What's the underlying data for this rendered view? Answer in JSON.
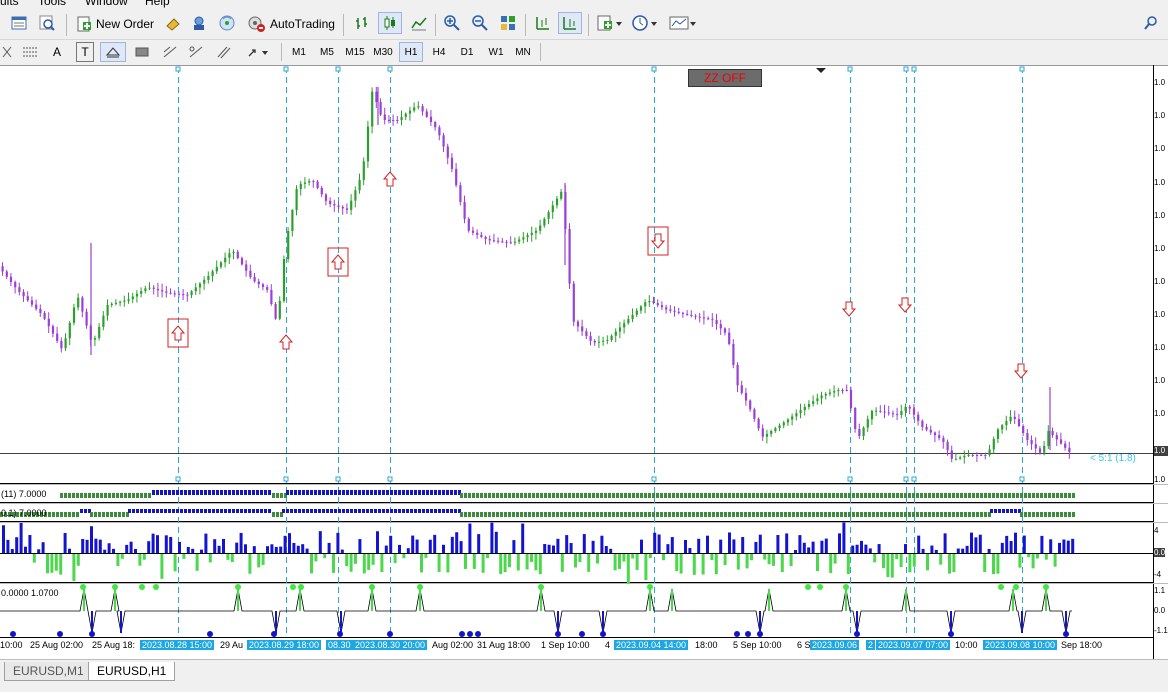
{
  "menu": {
    "items": [
      "ults",
      "Tools",
      "Window",
      "Help"
    ]
  },
  "toolbar": {
    "new_order_label": "New Order",
    "autotrading_label": "AutoTrading",
    "timeframes": [
      "M1",
      "M5",
      "M15",
      "M30",
      "H1",
      "H4",
      "D1",
      "W1",
      "MN"
    ],
    "active_timeframe": "H1",
    "drawing_tool_labels": [
      "A",
      "T"
    ]
  },
  "chart": {
    "zz_button_label": "ZZ OFF",
    "ratio_label": "< 5:1 (1.8)",
    "price_axis_labels": [
      "1.0",
      "1.0",
      "1.0",
      "1.0",
      "1.0",
      "1.0",
      "1.0",
      "1.0",
      "1.0",
      "1.0",
      "1.0",
      "1.0"
    ],
    "current_price_label": "1.0",
    "bar_indicator_1_label": "(11) 7.0000",
    "bar_indicator_2_label": "0.1) 7.0000",
    "histogram_axis": [
      "4",
      "0.0",
      "-4"
    ],
    "bottom_indicator_label": "0.0000 1.0700",
    "bottom_indicator_axis": [
      "1.1",
      "0.0",
      "-1.1"
    ],
    "x_axis_labels": [
      "10:00",
      "25 Aug 02:00",
      "25 Aug 18:",
      "29 Au",
      "Aug 02:00",
      "31 Aug 18:00",
      "1 Sep 10:00",
      "4",
      "18:00",
      "5 Sep 10:00",
      "6 S",
      "10:00",
      "Sep 18:00"
    ],
    "highlighted_x_labels": [
      "2023.08.28 15:00",
      "2023.08.29 18:00",
      "08.30",
      "2023.08.30 20:00",
      "2023.09.04 14:00",
      "2023.09.06",
      "2",
      "2023.09.07 07:00",
      "2023.09.08 10:00"
    ],
    "colors": {
      "bull": "#2ca02c",
      "bear": "#9b3fd6",
      "signal_line": "#2ba6d8",
      "arrow": "#d42020",
      "bar_green": "#3c8c3c",
      "bar_blue": "#1414c8",
      "hist_blue": "#1414d0",
      "hist_green": "#4cd84c"
    }
  },
  "tabs": [
    "EURUSD,M1",
    "EURUSD,H1"
  ],
  "active_tab": "EURUSD,H1"
}
